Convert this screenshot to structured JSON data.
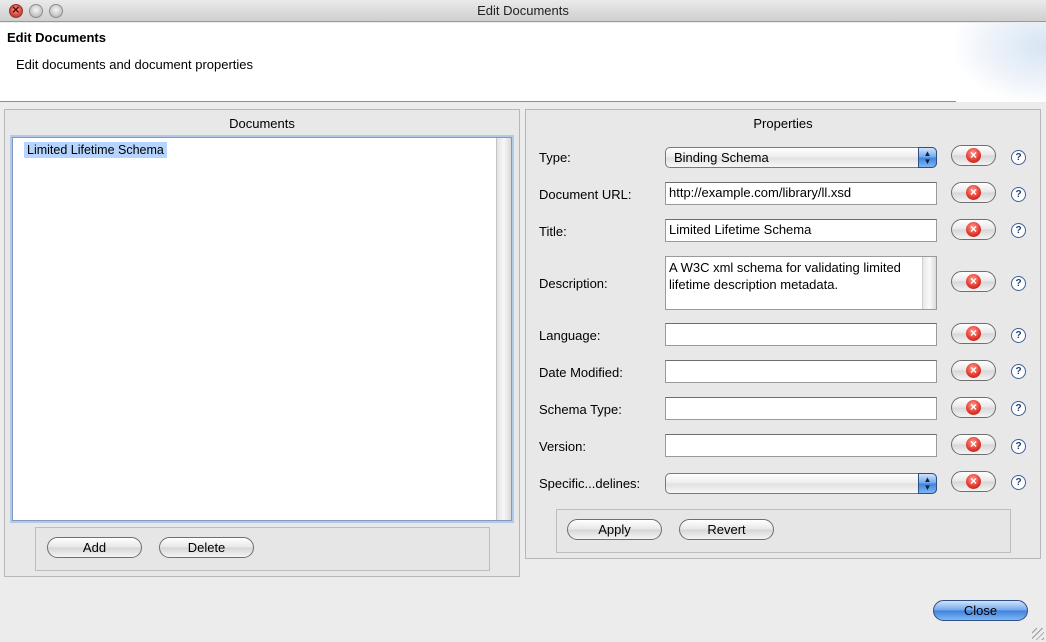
{
  "window": {
    "title": "Edit Documents"
  },
  "header": {
    "title": "Edit Documents",
    "subtitle": "Edit documents and document properties"
  },
  "documents": {
    "title": "Documents",
    "items": [
      "Limited Lifetime Schema"
    ],
    "add_label": "Add",
    "delete_label": "Delete"
  },
  "properties": {
    "title": "Properties",
    "type": {
      "label": "Type:",
      "value": "Binding Schema"
    },
    "document_url": {
      "label": "Document URL:",
      "value": "http://example.com/library/ll.xsd"
    },
    "title_field": {
      "label": "Title:",
      "value": "Limited Lifetime Schema"
    },
    "description": {
      "label": "Description:",
      "value": "A W3C xml schema for validating limited lifetime description metadata."
    },
    "language": {
      "label": "Language:",
      "value": ""
    },
    "date_modified": {
      "label": "Date Modified:",
      "value": ""
    },
    "schema_type": {
      "label": "Schema Type:",
      "value": ""
    },
    "version": {
      "label": "Version:",
      "value": ""
    },
    "specification_guidelines": {
      "label": "Specific...delines:",
      "value": ""
    },
    "apply_label": "Apply",
    "revert_label": "Revert",
    "help_glyph": "?",
    "clear_glyph": "×",
    "clear_icon": "red-x-clear-icon",
    "help_icon": "question-help-icon"
  },
  "footer": {
    "close_label": "Close"
  },
  "colors": {
    "selection": "#b5d5ff",
    "default_button": "#3f82dc",
    "clear_red": "#e0342a"
  }
}
